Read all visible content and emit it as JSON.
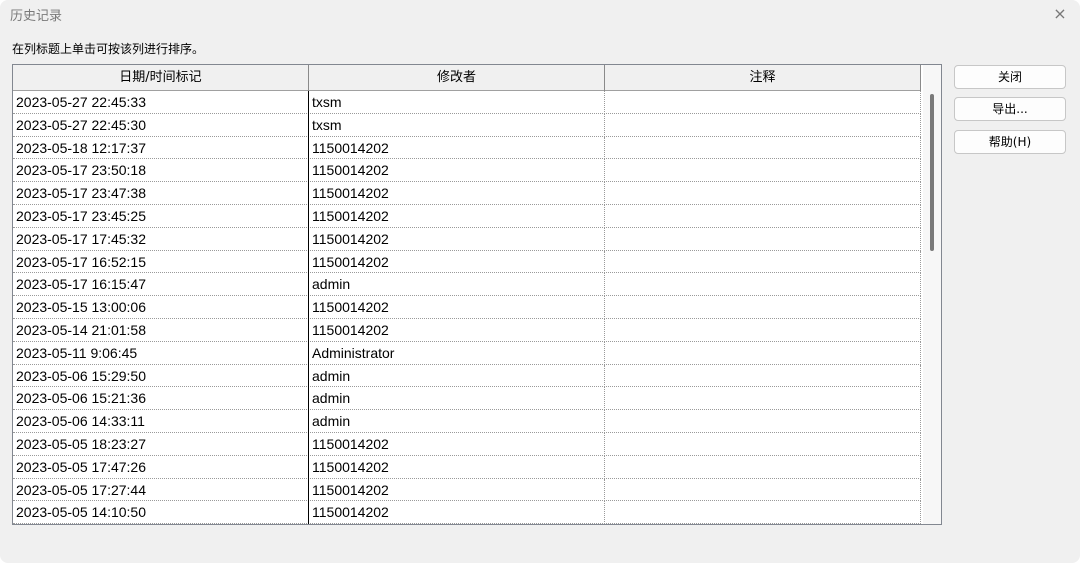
{
  "window": {
    "title": "历史记录",
    "close_glyph": "×"
  },
  "hint": "在列标题上单击可按该列进行排序。",
  "table": {
    "columns": [
      "日期/时间标记",
      "修改者",
      "注释"
    ],
    "rows": [
      [
        "2023-05-27 22:45:33",
        "txsm",
        ""
      ],
      [
        "2023-05-27 22:45:30",
        "txsm",
        ""
      ],
      [
        "2023-05-18 12:17:37",
        "1150014202",
        ""
      ],
      [
        "2023-05-17 23:50:18",
        "1150014202",
        ""
      ],
      [
        "2023-05-17 23:47:38",
        "1150014202",
        ""
      ],
      [
        "2023-05-17 23:45:25",
        "1150014202",
        ""
      ],
      [
        "2023-05-17 17:45:32",
        "1150014202",
        ""
      ],
      [
        "2023-05-17 16:52:15",
        "1150014202",
        ""
      ],
      [
        "2023-05-17 16:15:47",
        "admin",
        ""
      ],
      [
        "2023-05-15 13:00:06",
        "1150014202",
        ""
      ],
      [
        "2023-05-14 21:01:58",
        "1150014202",
        ""
      ],
      [
        "2023-05-11 9:06:45",
        "Administrator",
        ""
      ],
      [
        "2023-05-06 15:29:50",
        "admin",
        ""
      ],
      [
        "2023-05-06 15:21:36",
        "admin",
        ""
      ],
      [
        "2023-05-06 14:33:11",
        "admin",
        ""
      ],
      [
        "2023-05-05 18:23:27",
        "1150014202",
        ""
      ],
      [
        "2023-05-05 17:47:26",
        "1150014202",
        ""
      ],
      [
        "2023-05-05 17:27:44",
        "1150014202",
        ""
      ],
      [
        "2023-05-05 14:10:50",
        "1150014202",
        ""
      ]
    ]
  },
  "buttons": {
    "close": "关闭",
    "export": "导出...",
    "help": "帮助(H)"
  }
}
